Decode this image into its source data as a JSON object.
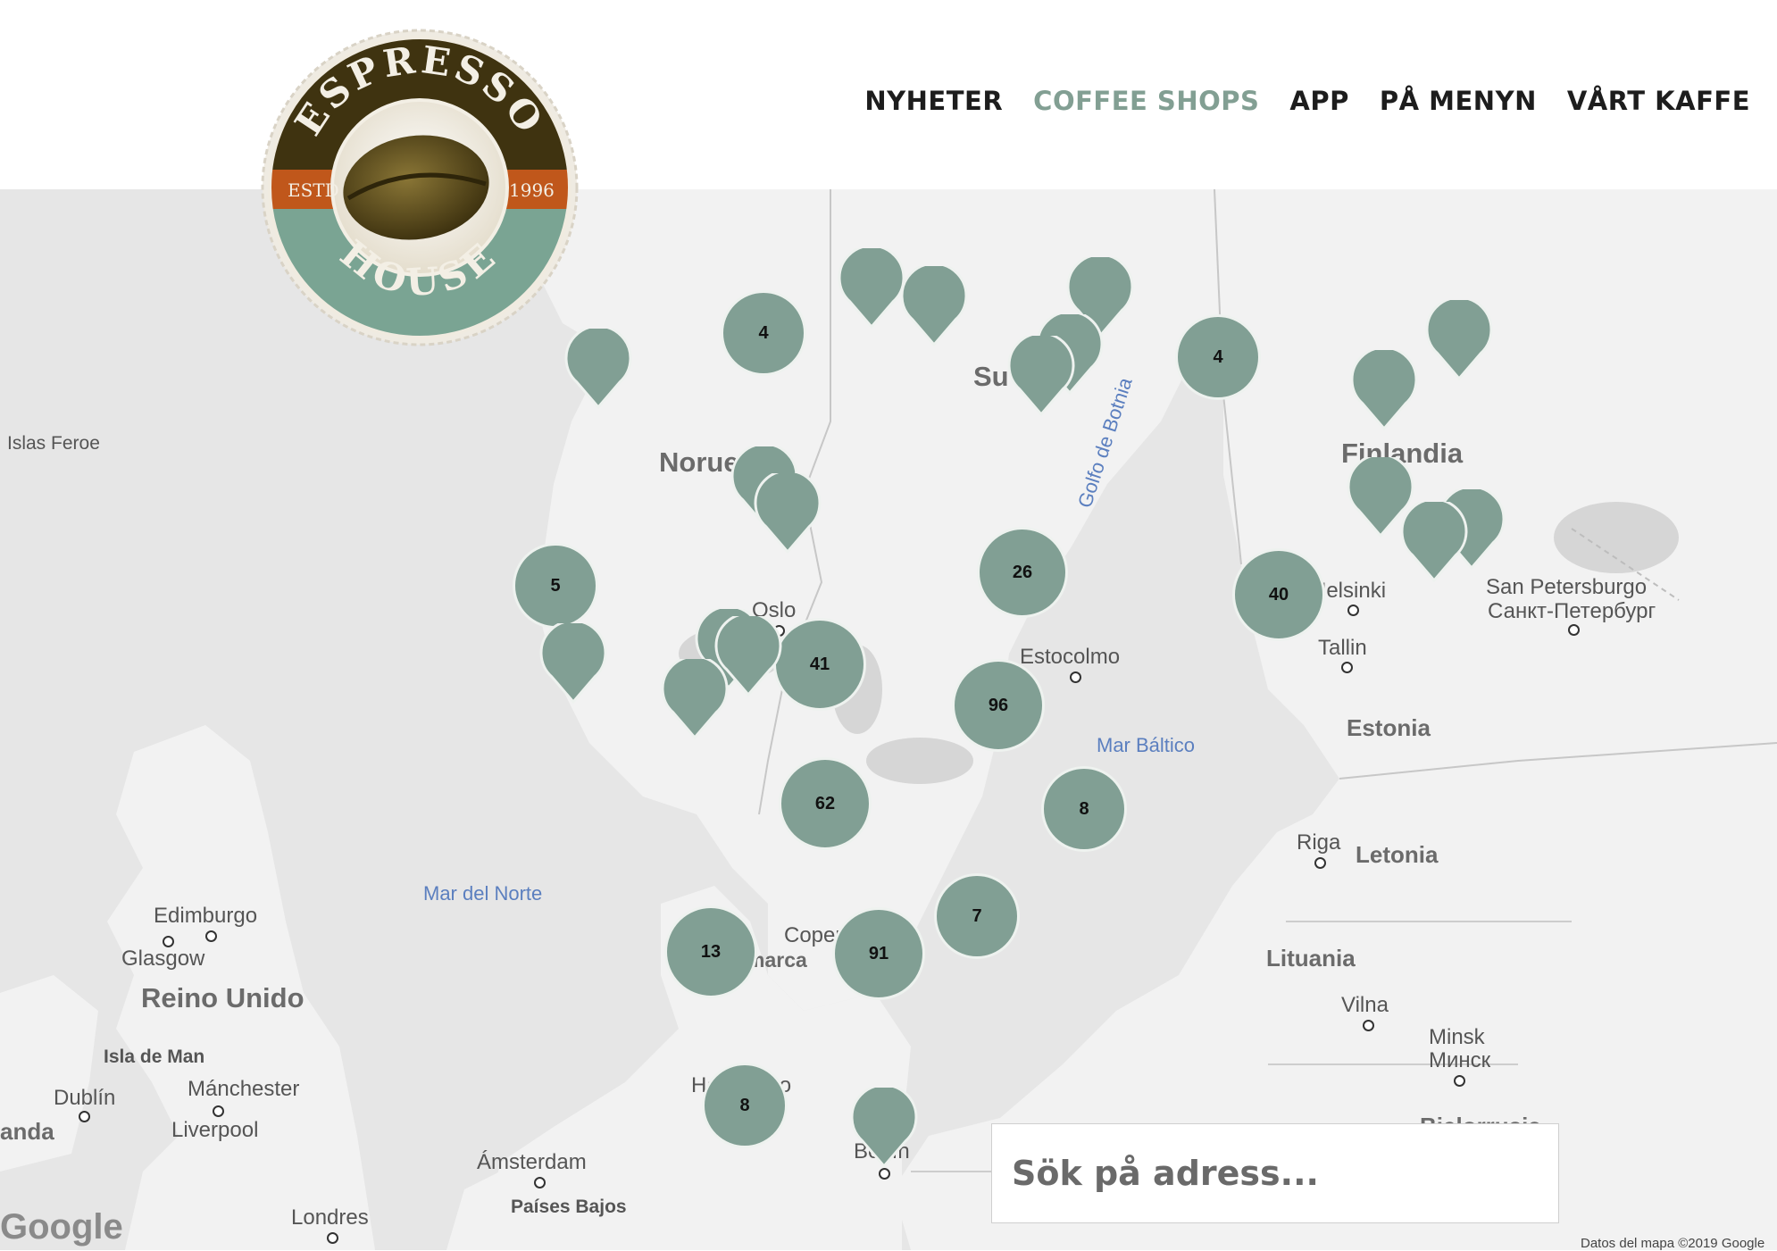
{
  "nav": {
    "items": [
      {
        "label": "NYHETER",
        "active": false
      },
      {
        "label": "COFFEE SHOPS",
        "active": true
      },
      {
        "label": "APP",
        "active": false
      },
      {
        "label": "PÅ MENYN",
        "active": false
      },
      {
        "label": "VÅRT KAFFE",
        "active": false
      }
    ],
    "active_color": "#829f93"
  },
  "logo": {
    "top_text": "ESPRESSO",
    "bottom_text": "HOUSE",
    "left_badge": "ESTD",
    "right_badge": "1996"
  },
  "map": {
    "labels": {
      "islas_feroe": "Islas Feroe",
      "noruega": "Norue",
      "suecia": "Su",
      "finlandia": "Finlandia",
      "golfo": "Golfo de Botnia",
      "helsinki": "Helsinki",
      "san_petersburgo": "San Petersburgo",
      "san_petersburgo_ru": "Санкт-Петербург",
      "oslo": "Oslo",
      "estocolmo": "Estocolmo",
      "tallin": "Tallin",
      "estonia": "Estonia",
      "mar_baltico": "Mar Báltico",
      "mar_norte": "Mar del Norte",
      "riga": "Riga",
      "letonia": "Letonia",
      "edimburgo": "Edimburgo",
      "glasgow": "Glasgow",
      "reino_unido": "Reino Unido",
      "lituania": "Lituania",
      "copenhague": "Copenhague",
      "dinamarca": "marca",
      "vilna": "Vilna",
      "isla_de_man": "Isla de Man",
      "dublin": "Dublín",
      "manchester": "Mánchester",
      "liverpool": "Liverpool",
      "minsk": "Minsk",
      "minsk_ru": "Минск",
      "anda": "anda",
      "hamburgo": "Hamburgo",
      "amsterdam": "Ámsterdam",
      "paises_bajos": "Países Bajos",
      "londres": "Londres",
      "berlin": "Berlín",
      "bielorrusia": "Bielorrusia"
    },
    "clusters": [
      "4",
      "4",
      "5",
      "26",
      "40",
      "41",
      "96",
      "62",
      "8",
      "7",
      "13",
      "91",
      "8"
    ],
    "pin_color": "#819f94",
    "google_label": "Google",
    "attribution": "Datos del mapa ©2019 Google"
  },
  "search": {
    "placeholder": "Sök på adress..."
  }
}
